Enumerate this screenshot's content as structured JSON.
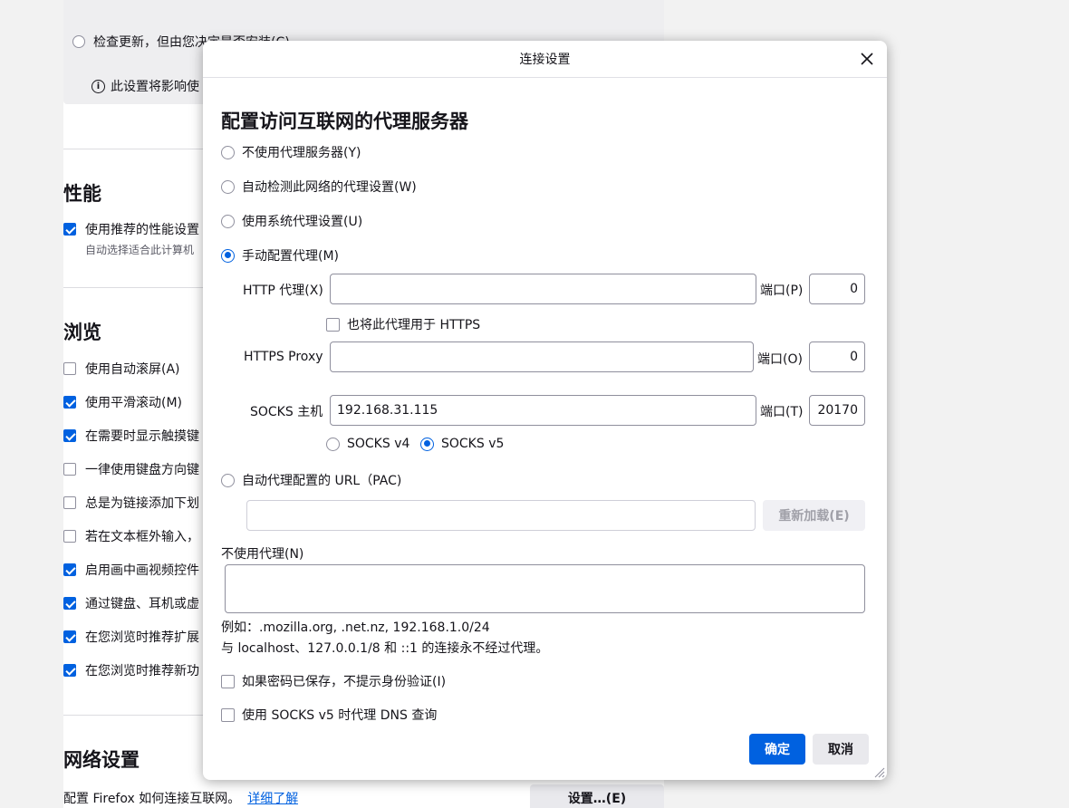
{
  "background": {
    "update_option_label": "检查更新，但由您决定是否安装(C)",
    "info_text": "此设置将影响使",
    "performance_heading": "性能",
    "performance_option": "使用推荐的性能设置",
    "performance_sub": "自动选择适合此计算机",
    "browsing_heading": "浏览",
    "browsing_items": [
      {
        "label": "使用自动滚屏(A)",
        "checked": false
      },
      {
        "label": "使用平滑滚动(M)",
        "checked": true
      },
      {
        "label": "在需要时显示触摸键",
        "checked": true
      },
      {
        "label": "一律使用键盘方向键",
        "checked": false
      },
      {
        "label": "总是为链接添加下划",
        "checked": false
      },
      {
        "label": "若在文本框外输入，",
        "checked": false
      },
      {
        "label": "启用画中画视频控件",
        "checked": true
      },
      {
        "label": "通过键盘、耳机或虚",
        "checked": true
      },
      {
        "label": "在您浏览时推荐扩展",
        "checked": true
      },
      {
        "label": "在您浏览时推荐新功",
        "checked": true
      }
    ],
    "network_heading": "网络设置",
    "network_desc": "配置 Firefox 如何连接互联网。",
    "network_link": "详细了解",
    "settings_button": "设置…(E)"
  },
  "dialog": {
    "title": "连接设置",
    "heading": "配置访问互联网的代理服务器",
    "proxy_modes": [
      {
        "label": "不使用代理服务器(Y)",
        "selected": false
      },
      {
        "label": "自动检测此网络的代理设置(W)",
        "selected": false
      },
      {
        "label": "使用系统代理设置(U)",
        "selected": false
      },
      {
        "label": "手动配置代理(M)",
        "selected": true
      }
    ],
    "http_proxy_label": "HTTP 代理(X)",
    "http_proxy_value": "",
    "port_label_http": "端口(P)",
    "http_port": "0",
    "also_https_label": "也将此代理用于 HTTPS",
    "https_proxy_label": "HTTPS Proxy",
    "https_proxy_value": "",
    "port_label_https": "端口(O)",
    "https_port": "0",
    "socks_host_label": "SOCKS 主机",
    "socks_host_value": "192.168.31.115",
    "port_label_socks": "端口(T)",
    "socks_port": "20170",
    "socks_v4_label": "SOCKS v4",
    "socks_v5_label": "SOCKS v5",
    "socks_version_selected": "v5",
    "pac_label": "自动代理配置的 URL（PAC)",
    "pac_value": "",
    "reload_button": "重新加载(E)",
    "no_proxy_label": "不使用代理(N)",
    "no_proxy_value": "",
    "example_text": "例如：.mozilla.org, .net.nz, 192.168.1.0/24",
    "localhost_note": "与 localhost、127.0.0.1/8 和 ::1 的连接永不经过代理。",
    "no_auth_prompt_label": "如果密码已保存，不提示身份验证(I)",
    "socks_dns_label": "使用 SOCKS v5 时代理 DNS 查询",
    "ok_button": "确定",
    "cancel_button": "取消"
  },
  "colors": {
    "accent": "#0061e0",
    "border": "#8f8f9d",
    "secondary_button": "#e9e9ed"
  }
}
